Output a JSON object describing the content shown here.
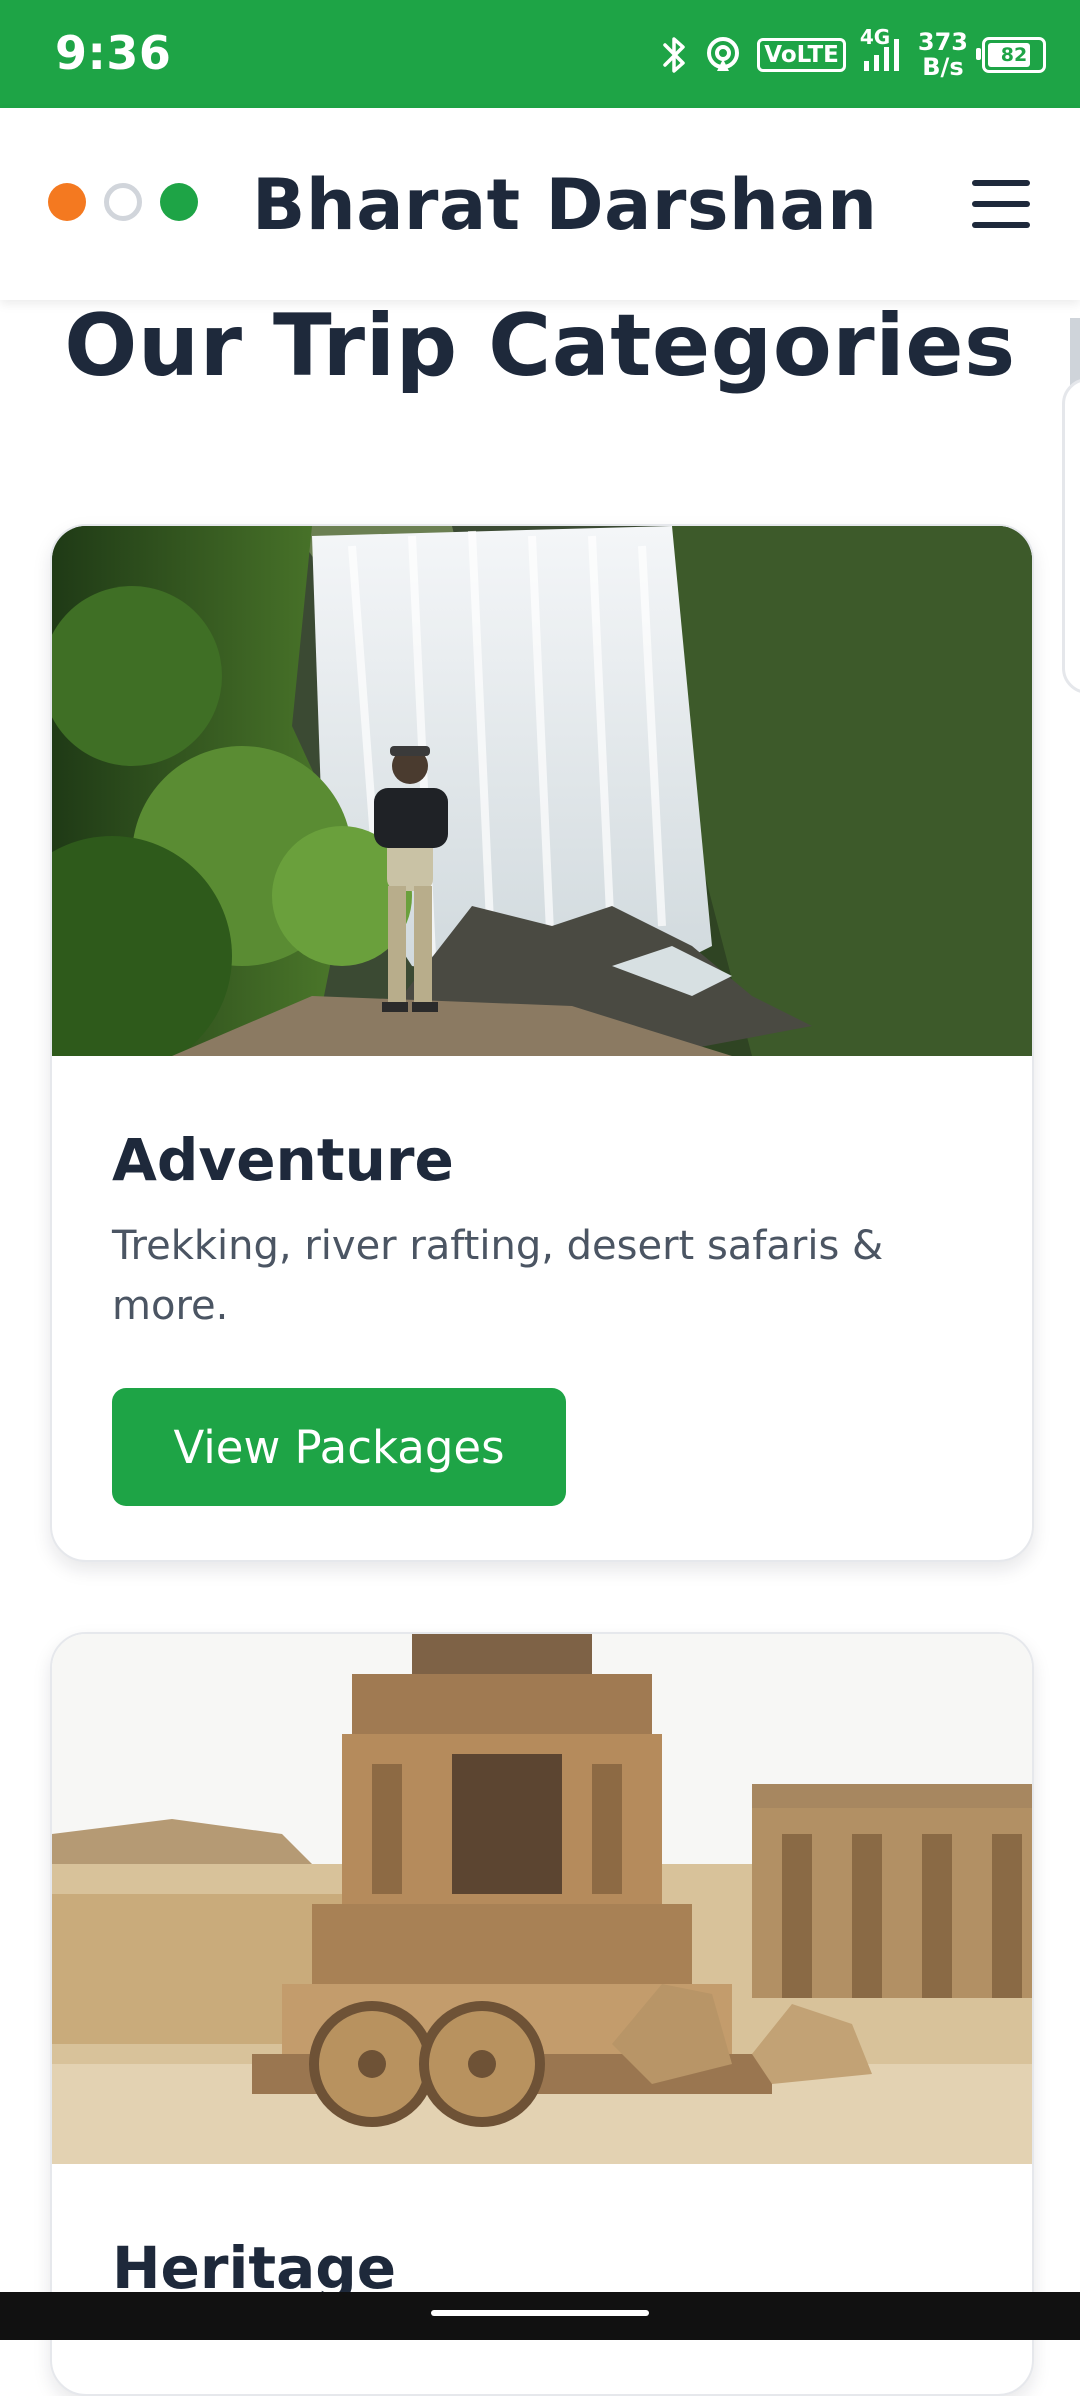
{
  "status_bar": {
    "time": "9:36",
    "volte_label": "VoLTE",
    "network_type": "4G",
    "speed_value": "373",
    "speed_unit": "B/s",
    "battery_level": "82",
    "icons": [
      "bluetooth-icon",
      "hotspot-icon",
      "signal-icon",
      "battery-icon"
    ]
  },
  "header": {
    "brand_title": "Bharat Darshan",
    "logo_colors": [
      "#f47920",
      "#ffffff",
      "#1ea446"
    ],
    "menu_icon": "hamburger-menu-icon"
  },
  "main": {
    "section_title": "Our Trip Categories",
    "categories": [
      {
        "title": "Adventure",
        "description": "Trekking, river rafting, desert safaris & more.",
        "button_label": "View Packages",
        "image": "hiker-at-waterfall"
      },
      {
        "title": "Heritage",
        "image": "stone-chariot-temple"
      }
    ]
  },
  "colors": {
    "brand_green": "#1ea446",
    "saffron": "#f47920",
    "heading_text": "#1e293b",
    "body_text": "#4b5563"
  }
}
